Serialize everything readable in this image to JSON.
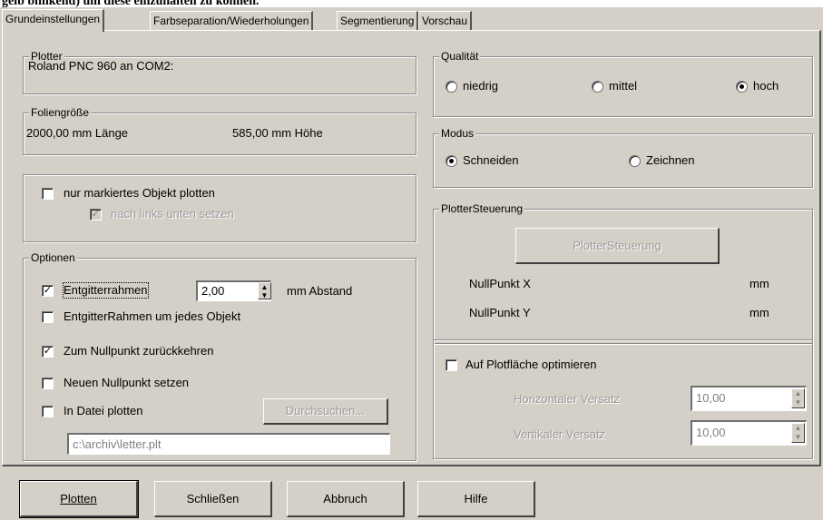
{
  "header_text": "gelb blinkend) um diese einzuhalten zu können.",
  "tabs": [
    "Grundeinstellungen",
    "Farbseparation/Wiederholungen",
    "Segmentierung",
    "Vorschau"
  ],
  "plotter": {
    "legend": "Plotter",
    "value": "Roland PNC 960 an COM2:"
  },
  "foil": {
    "legend": "Foliengröße",
    "length": "2000,00 mm Länge",
    "height": "585,00 mm Höhe"
  },
  "marked": {
    "only_marked_label": "nur markiertes Objekt plotten",
    "move_label": "nach links unten setzen"
  },
  "options": {
    "legend": "Optionen",
    "weed_frame_label": "Entgitterrahmen",
    "weed_frame_value": "2,00",
    "weed_frame_unit": "mm Abstand",
    "weed_each_label": "EntgitterRahmen um jedes Objekt",
    "return_zero_label": "Zum Nullpunkt zurückkehren",
    "new_zero_label": "Neuen Nullpunkt setzen",
    "to_file_label": "In Datei plotten",
    "browse_label": "Durchsuchen...",
    "file_path": "c:\\archiv\\letter.plt"
  },
  "quality": {
    "legend": "Qualität",
    "low": "niedrig",
    "mid": "mittel",
    "high": "hoch",
    "selected": "hoch"
  },
  "mode": {
    "legend": "Modus",
    "cut": "Schneiden",
    "draw": "Zeichnen",
    "selected": "Schneiden"
  },
  "control": {
    "legend": "PlotterSteuerung",
    "button_label": "PlotterSteuerung",
    "zero_x_label": "NullPunkt X",
    "zero_x_unit": "mm",
    "zero_y_label": "NullPunkt Y",
    "zero_y_unit": "mm"
  },
  "optimize": {
    "label": "Auf Plotfläche optimieren",
    "h_offset_label": "Horizontaler Versatz",
    "h_offset_value": "10,00",
    "v_offset_label": "Vertikaler Versatz",
    "v_offset_value": "10,00"
  },
  "footer": {
    "plot": "Plotten",
    "close": "Schließen",
    "cancel": "Abbruch",
    "help": "Hilfe"
  }
}
